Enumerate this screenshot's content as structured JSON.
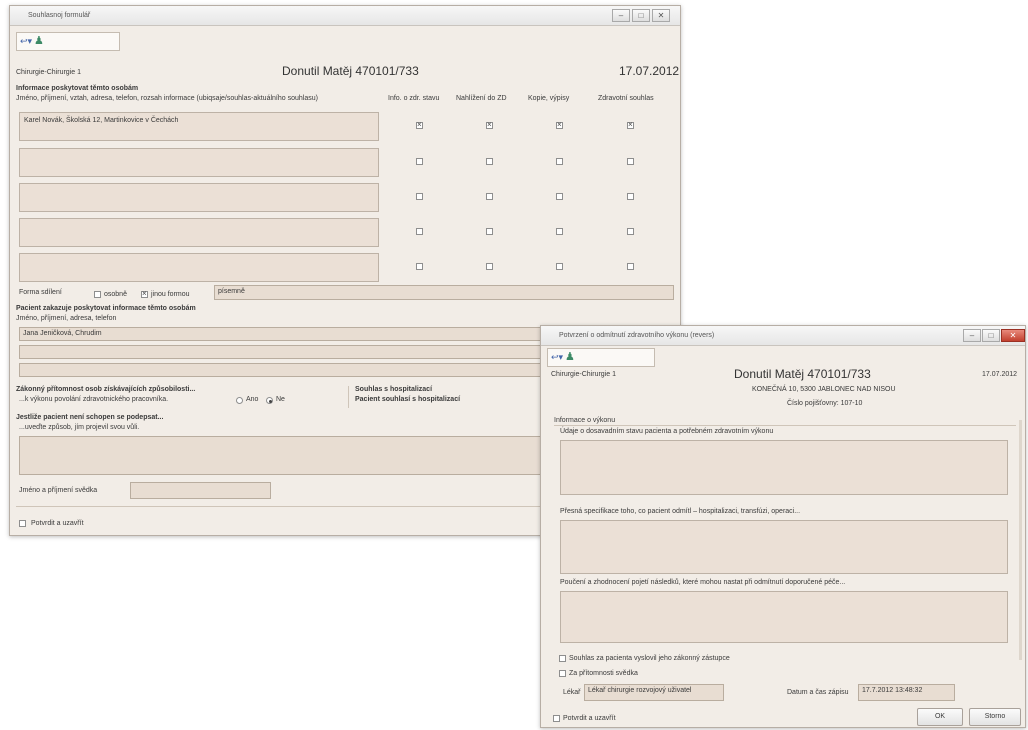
{
  "window1": {
    "title": "Souhlasnoj formulář",
    "unit": "Chirurgie-Chirurgie 1",
    "patient": "Donutil Matěj 470101/733",
    "date": "17.07.2012",
    "section_info_title": "Informace poskytovat těmto osobám",
    "section_info_sub": "Jméno, příjmení, vztah, adresa, telefon, rozsah informace (ubiqsaje/souhlas-aktuálního souhlasu)",
    "columns": [
      "Info. o zdr. stavu",
      "Nahlížení do ZD",
      "Kopie, výpisy",
      "Zdravotní souhlas"
    ],
    "rows": [
      {
        "text": "Karel Novák, Školská 12, Martinkovice v Čechách",
        "checks": [
          true,
          true,
          true,
          true
        ]
      },
      {
        "text": "",
        "checks": [
          false,
          false,
          false,
          false
        ]
      },
      {
        "text": "",
        "checks": [
          false,
          false,
          false,
          false
        ]
      },
      {
        "text": "",
        "checks": [
          false,
          false,
          false,
          false
        ]
      },
      {
        "text": "",
        "checks": [
          false,
          false,
          false,
          false
        ]
      }
    ],
    "forma_label": "Forma sdílení",
    "forma_opt1": "osobně",
    "forma_opt2": "jinou formou",
    "forma_value": "písemně",
    "section_deny_title": "Pacient zakazuje poskytovat informace těmto osobám",
    "section_deny_sub": "Jméno, příjmení, adresa, telefon",
    "deny_value": "Jana Jeničková, Chrudim",
    "section_zakonny_title": "Zákonný přítomnost osob získávajících způsobilosti...",
    "section_zakonny_sub": "...k výkonu povolání zdravotnického pracovníka.",
    "ano": "Ano",
    "ne": "Ne",
    "souhlas_title": "Souhlas s hospitalizací",
    "souhlas_sub": "Pacient souhlasí s hospitalizací",
    "section_nemuze_title": "Jestliže pacient není schopen se podepsat...",
    "section_nemuze_sub": "...uveďte způsob, jím projevil svou vůli.",
    "svedek_label": "Jméno a příjmení svědka",
    "potvrdit": "Potvrdit a uzavřít"
  },
  "window2": {
    "title": "Potvrzení o odmítnutí zdravotního výkonu (revers)",
    "unit": "Chirurgie-Chirurgie 1",
    "patient": "Donutil Matěj 470101/733",
    "date": "17.07.2012",
    "address": "KONEČNÁ 10, 5300 JABLONEC NAD NISOU",
    "insurance": "Číslo pojišťovny: 107-10",
    "info_group": "Informace o výkonu",
    "label1": "Údaje o dosavadním stavu pacienta a potřebném zdravotním výkonu",
    "label2": "Přesná specifikace toho, co pacient odmítl – hospitalizaci, transfúzi, operaci...",
    "label3": "Poučení a zhodnocení pojetí následků, které mohou nastat při odmítnutí doporučené péče...",
    "chk1": "Souhlas za pacienta vyslovil jeho zákonný zástupce",
    "chk2": "Za přítomnosti svědka",
    "lekar_label": "Lékař",
    "lekar_value": "Lékař chirurgie rozvojový uživatel",
    "datum_label": "Datum a čas zápisu",
    "datum_value": "17.7.2012 13:48:32",
    "potvrdit": "Potvrdit a uzavřít",
    "ok": "OK",
    "storno": "Storno"
  }
}
